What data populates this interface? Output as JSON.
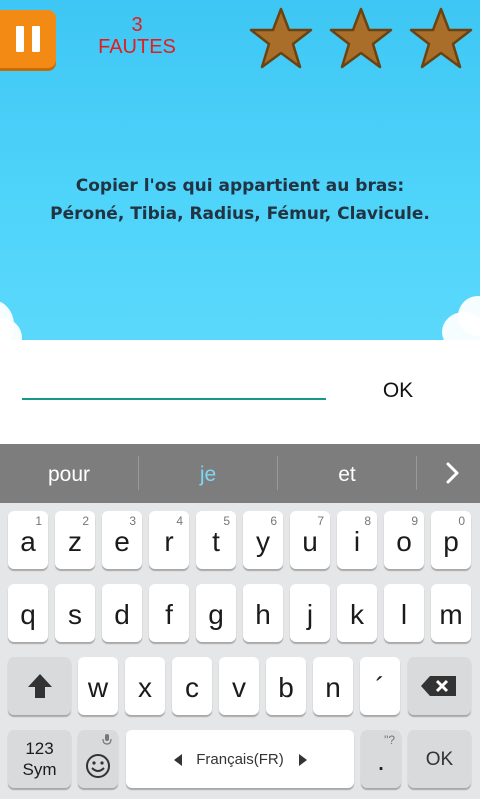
{
  "game": {
    "faults_count": "3",
    "faults_label": "FAUTES",
    "question_line1": "Copier l'os qui appartient au bras:",
    "question_line2": "Péroné, Tibia, Radius, Fémur, Clavicule.",
    "stars_earned": 3,
    "colors": {
      "sky": "#4fd4fa",
      "pause": "#f28a14",
      "star": "#a86e2a",
      "faults": "#e21d1d"
    }
  },
  "answer": {
    "value": "",
    "placeholder": "",
    "ok_label": "OK"
  },
  "suggestions": [
    "pour",
    "je",
    "et"
  ],
  "keyboard": {
    "row1": [
      {
        "letter": "a",
        "num": "1"
      },
      {
        "letter": "z",
        "num": "2"
      },
      {
        "letter": "e",
        "num": "3"
      },
      {
        "letter": "r",
        "num": "4"
      },
      {
        "letter": "t",
        "num": "5"
      },
      {
        "letter": "y",
        "num": "6"
      },
      {
        "letter": "u",
        "num": "7"
      },
      {
        "letter": "i",
        "num": "8"
      },
      {
        "letter": "o",
        "num": "9"
      },
      {
        "letter": "p",
        "num": "0"
      }
    ],
    "row2": [
      "q",
      "s",
      "d",
      "f",
      "g",
      "h",
      "j",
      "k",
      "l",
      "m"
    ],
    "row3": [
      "w",
      "x",
      "c",
      "v",
      "b",
      "n",
      "´"
    ],
    "sym_label_1": "123",
    "sym_label_2": "Sym",
    "language_label": "Français(FR)",
    "period_label": ".",
    "period_hint": "\"?",
    "ok_label": "OK",
    "icons": {
      "shift": "shift-icon",
      "backspace": "backspace-icon",
      "emoji": "emoji-icon",
      "mic": "mic-icon"
    }
  }
}
